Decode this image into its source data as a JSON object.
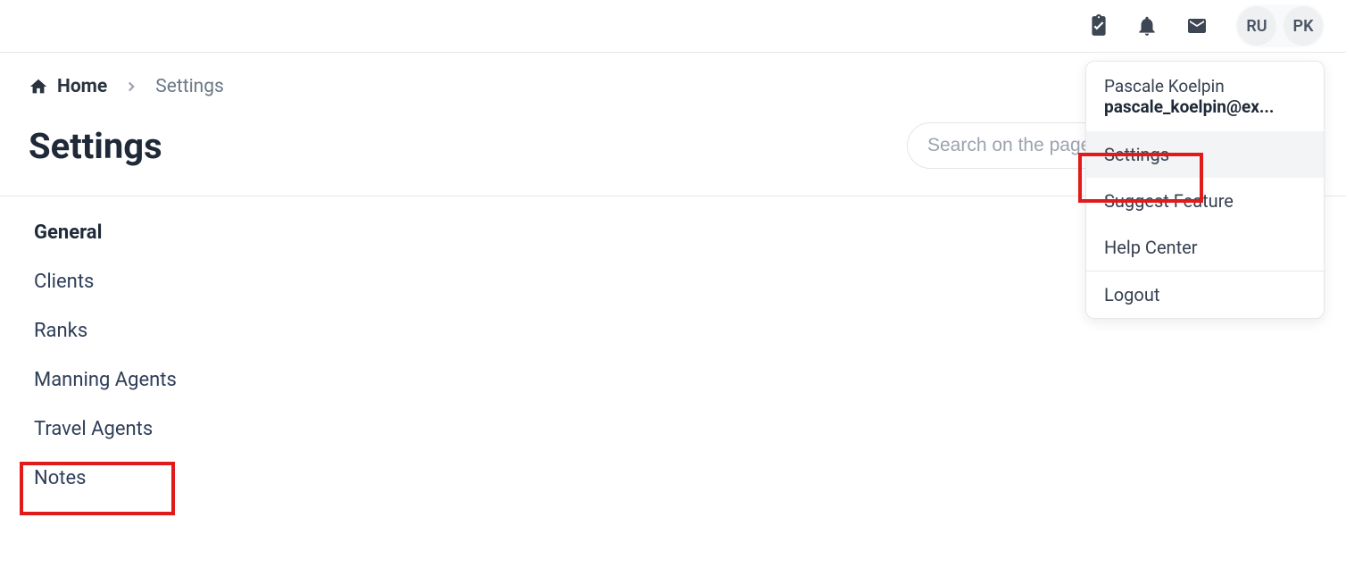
{
  "topbar": {
    "lang": "RU",
    "avatar_initials": "PK"
  },
  "breadcrumb": {
    "home_label": "Home",
    "current": "Settings"
  },
  "page": {
    "title": "Settings",
    "search_placeholder": "Search on the page"
  },
  "nav": {
    "items": [
      {
        "label": "General",
        "active": true
      },
      {
        "label": "Clients",
        "active": false
      },
      {
        "label": "Ranks",
        "active": false
      },
      {
        "label": "Manning Agents",
        "active": false
      },
      {
        "label": "Travel Agents",
        "active": false
      },
      {
        "label": "Notes",
        "active": false
      }
    ]
  },
  "dropdown": {
    "name": "Pascale Koelpin",
    "email": "pascale_koelpin@ex...",
    "items": [
      {
        "label": "Settings",
        "hover": true
      },
      {
        "label": "Suggest Feature",
        "hover": false
      },
      {
        "label": "Help Center",
        "hover": false
      }
    ],
    "logout": "Logout"
  }
}
